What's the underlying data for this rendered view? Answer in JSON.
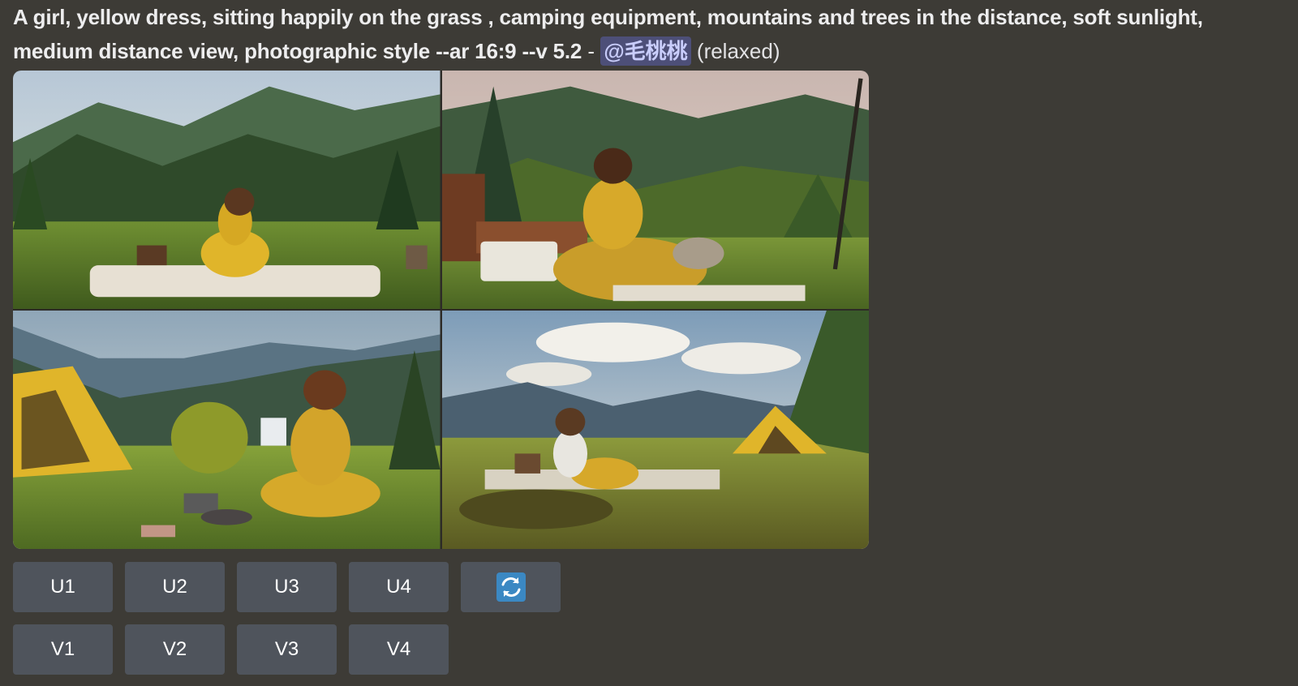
{
  "message": {
    "prompt": "A girl, yellow dress, sitting happily on the grass , camping equipment, mountains and trees in the distance, soft sunlight, medium distance view, photographic style --ar 16:9 --v 5.2",
    "separator": " - ",
    "mention": "@毛桃桃",
    "mode": "(relaxed)"
  },
  "images": [
    {
      "name": "image-1",
      "icon": "photo"
    },
    {
      "name": "image-2",
      "icon": "photo"
    },
    {
      "name": "image-3",
      "icon": "photo"
    },
    {
      "name": "image-4",
      "icon": "photo"
    }
  ],
  "buttons": {
    "upscale": [
      "U1",
      "U2",
      "U3",
      "U4"
    ],
    "variation": [
      "V1",
      "V2",
      "V3",
      "V4"
    ],
    "reroll_icon": "refresh-icon"
  },
  "colors": {
    "background": "#3d3b36",
    "button": "#4f545c",
    "mention_bg": "#4d4f78",
    "mention_text": "#c9cdfb",
    "reroll_icon": "#3b88c3"
  }
}
